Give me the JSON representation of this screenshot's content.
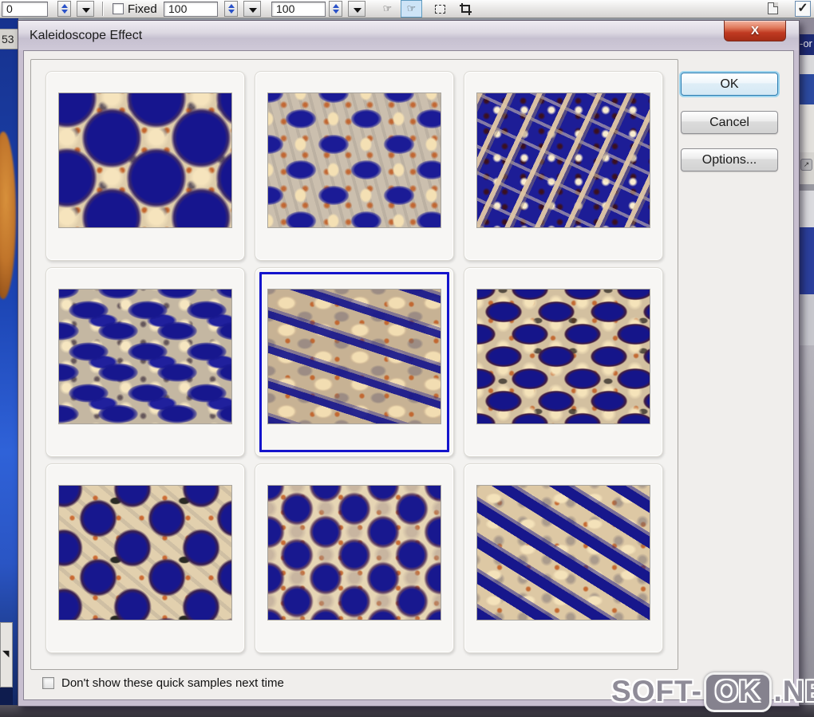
{
  "toolbar": {
    "value_a": "0",
    "fixed_label": "Fixed",
    "value_b": "100",
    "value_c": "100"
  },
  "background": {
    "left_ruler_value": "53",
    "right_fragment_text": "-or"
  },
  "dialog": {
    "title": "Kaleidoscope Effect",
    "close_label": "X",
    "buttons": {
      "ok": "OK",
      "cancel": "Cancel",
      "options": "Options..."
    },
    "checkbox_label": "Don't show these quick samples next time",
    "checkbox_checked": false,
    "samples": [
      {
        "name": "sample-1",
        "pattern": 1,
        "selected": false
      },
      {
        "name": "sample-2",
        "pattern": 2,
        "selected": false
      },
      {
        "name": "sample-3",
        "pattern": 3,
        "selected": false
      },
      {
        "name": "sample-4",
        "pattern": 4,
        "selected": false
      },
      {
        "name": "sample-5",
        "pattern": 5,
        "selected": true
      },
      {
        "name": "sample-6",
        "pattern": 6,
        "selected": false
      },
      {
        "name": "sample-7",
        "pattern": 7,
        "selected": false
      },
      {
        "name": "sample-8",
        "pattern": 8,
        "selected": false
      },
      {
        "name": "sample-9",
        "pattern": 9,
        "selected": false
      }
    ]
  },
  "watermark": {
    "prefix": "SOFT-",
    "boxed": "OK",
    "suffix": ".NET"
  },
  "colors": {
    "selection_blue": "#1414cc",
    "pattern_navy": "#1a1a94",
    "pattern_cream": "#ecd8b0",
    "close_button_red": "#c03a22",
    "dialog_frame": "#c8bfd0",
    "client_background": "#f0eeec"
  }
}
